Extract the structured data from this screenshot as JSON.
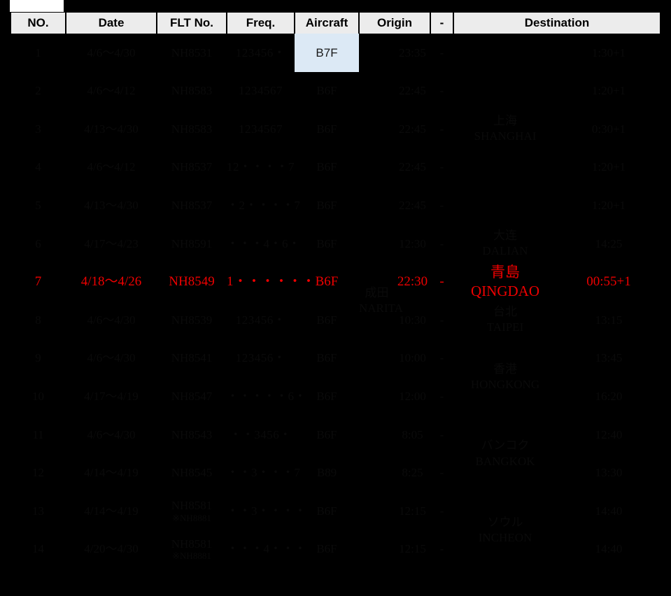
{
  "table": {
    "headers": {
      "no": "NO.",
      "date": "Date",
      "flt": "FLT No.",
      "freq": "Freq.",
      "aircraft": "Aircraft",
      "origin": "Origin",
      "dash": "-",
      "destination": "Destination"
    },
    "origin_name": {
      "cn": "成田",
      "en": "NARITA"
    },
    "highlight_color": "#ee0000",
    "highlight_cell_bg": "#dce9f5",
    "rows": [
      {
        "no": "1",
        "date": "4/6～4/30",
        "flt": "NH8531",
        "flt_sub": "",
        "freq": "123456・",
        "aircraft": "B7F",
        "dep": "23:35",
        "dash": "-",
        "arr": "1:30+1"
      },
      {
        "no": "2",
        "date": "4/6～4/12",
        "flt": "NH8583",
        "flt_sub": "",
        "freq": "1234567",
        "aircraft": "B6F",
        "dep": "22:45",
        "dash": "-",
        "arr": "1:20+1"
      },
      {
        "no": "3",
        "date": "4/13～4/30",
        "flt": "NH8583",
        "flt_sub": "",
        "freq": "1234567",
        "aircraft": "B6F",
        "dep": "22:45",
        "dash": "-",
        "arr": "0:30+1"
      },
      {
        "no": "4",
        "date": "4/6～4/12",
        "flt": "NH8537",
        "flt_sub": "",
        "freq": "12・・・・7",
        "aircraft": "B6F",
        "dep": "22:45",
        "dash": "-",
        "arr": "1:20+1"
      },
      {
        "no": "5",
        "date": "4/13～4/30",
        "flt": "NH8537",
        "flt_sub": "",
        "freq": "・2・・・・7",
        "aircraft": "B6F",
        "dep": "22:45",
        "dash": "-",
        "arr": "1:20+1"
      },
      {
        "no": "6",
        "date": "4/17～4/23",
        "flt": "NH8591",
        "flt_sub": "",
        "freq": "・・・4・6・",
        "aircraft": "B6F",
        "dep": "12:30",
        "dash": "-",
        "arr": "14:25"
      },
      {
        "no": "7",
        "date": "4/18～4/26",
        "flt": "NH8549",
        "flt_sub": "",
        "freq": "1・・・・・・",
        "aircraft": "B6F",
        "dep": "22:30",
        "dash": "-",
        "arr": "00:55+1"
      },
      {
        "no": "8",
        "date": "4/6～4/30",
        "flt": "NH8539",
        "flt_sub": "",
        "freq": "123456・",
        "aircraft": "B6F",
        "dep": "10:30",
        "dash": "-",
        "arr": "13:15"
      },
      {
        "no": "9",
        "date": "4/6～4/30",
        "flt": "NH8541",
        "flt_sub": "",
        "freq": "123456・",
        "aircraft": "B6F",
        "dep": "10:00",
        "dash": "-",
        "arr": "13:45"
      },
      {
        "no": "10",
        "date": "4/17～4/19",
        "flt": "NH8547",
        "flt_sub": "",
        "freq": "・・・・・6・",
        "aircraft": "B6F",
        "dep": "12:00",
        "dash": "-",
        "arr": "16:20"
      },
      {
        "no": "11",
        "date": "4/6～4/30",
        "flt": "NH8543",
        "flt_sub": "",
        "freq": "・・3456・",
        "aircraft": "B6F",
        "dep": "8:05",
        "dash": "-",
        "arr": "12:40"
      },
      {
        "no": "12",
        "date": "4/14～4/19",
        "flt": "NH8545",
        "flt_sub": "",
        "freq": "・・3・・・7",
        "aircraft": "B89",
        "dep": "8:25",
        "dash": "-",
        "arr": "13:30"
      },
      {
        "no": "13",
        "date": "4/14～4/19",
        "flt": "NH8581",
        "flt_sub": "※NH8881",
        "freq": "・・3・・・・",
        "aircraft": "B6F",
        "dep": "12:15",
        "dash": "-",
        "arr": "14:40"
      },
      {
        "no": "14",
        "date": "4/20～4/30",
        "flt": "NH8581",
        "flt_sub": "※NH8881",
        "freq": "・・・4・・・",
        "aircraft": "B6F",
        "dep": "12:15",
        "dash": "-",
        "arr": "14:40"
      }
    ],
    "destination_groups": [
      {
        "cn": "上海",
        "en": "SHANGHAI",
        "span": 5,
        "highlight": false
      },
      {
        "cn": "大连",
        "en": "DALIAN",
        "span": 1,
        "highlight": false
      },
      {
        "cn": "青島",
        "en": "QINGDAO",
        "span": 1,
        "highlight": true
      },
      {
        "cn": "台北",
        "en": "TAIPEI",
        "span": 1,
        "highlight": false
      },
      {
        "cn": "香港",
        "en": "HONGKONG",
        "span": 2,
        "highlight": false
      },
      {
        "cn": "バンコク",
        "en": "BANGKOK",
        "span": 2,
        "highlight": false
      },
      {
        "cn": "ソウル",
        "en": "INCHEON",
        "span": 2,
        "highlight": false
      }
    ]
  }
}
